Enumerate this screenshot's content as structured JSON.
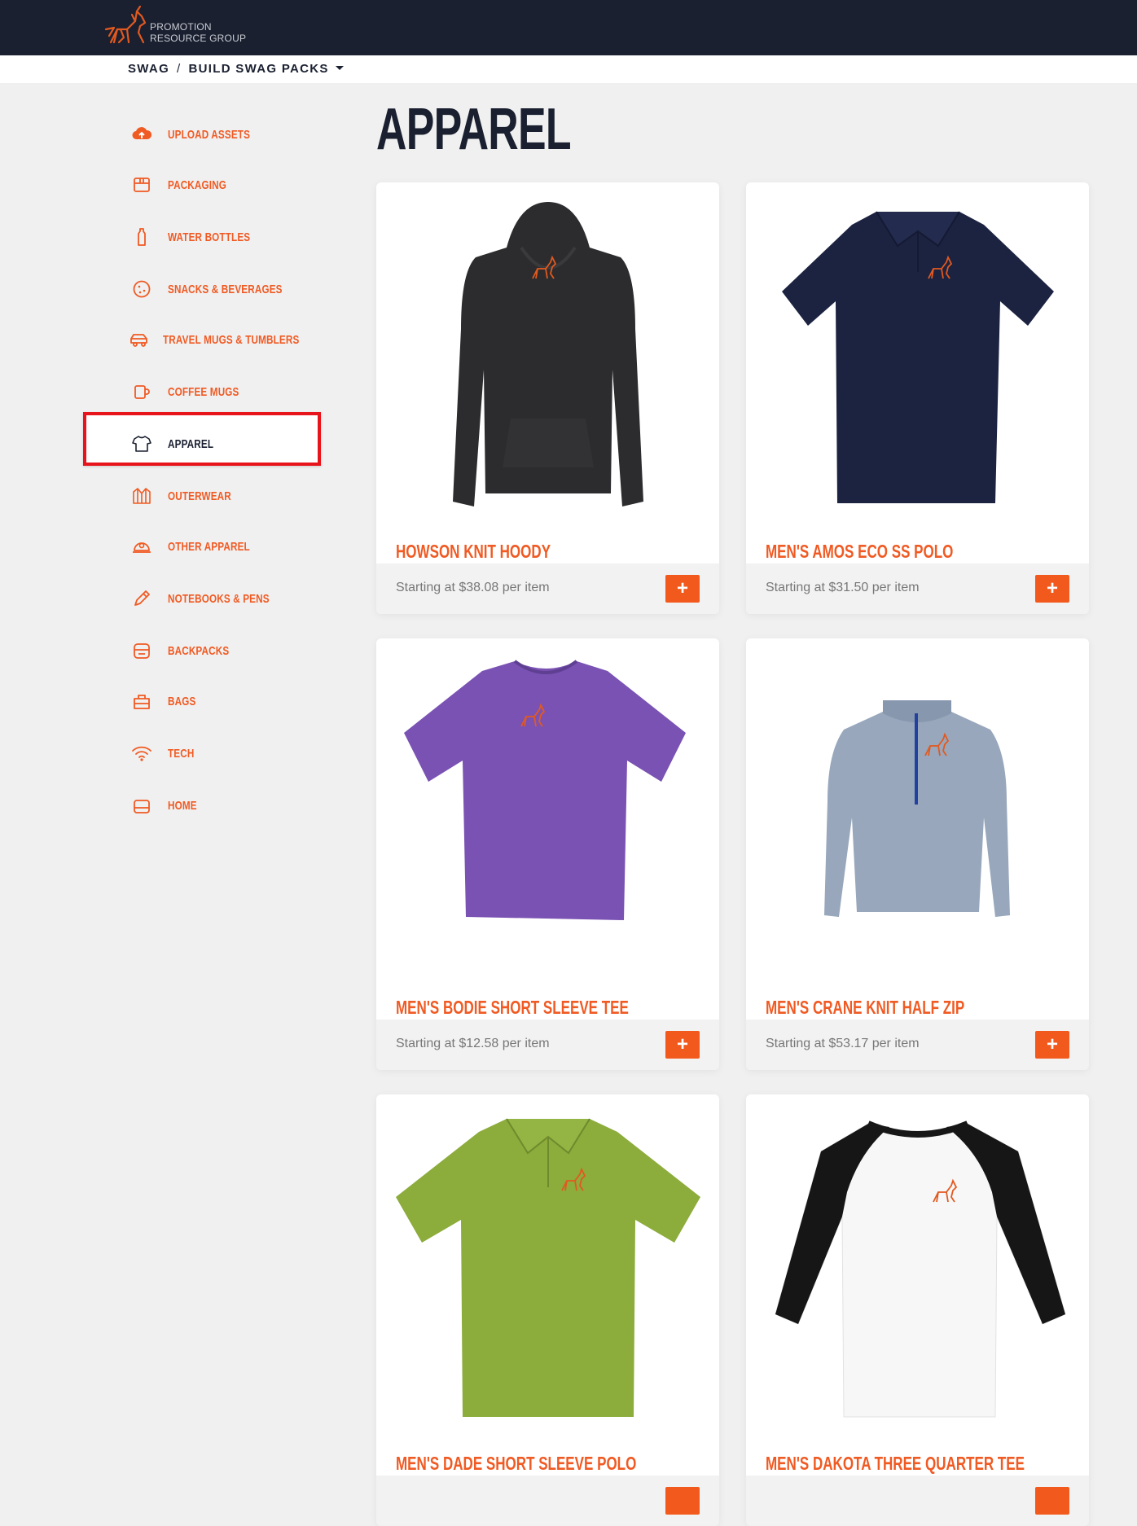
{
  "brand": {
    "name_line1": "PROMOTION",
    "name_line2": "RESOURCE GROUP",
    "accent": "#f05a23",
    "dark": "#1a2030"
  },
  "breadcrumb": {
    "root": "SWAG",
    "separator": "/",
    "current": "BUILD SWAG PACKS"
  },
  "sidebar": {
    "items": [
      {
        "label": "UPLOAD ASSETS",
        "icon": "cloud-upload-icon"
      },
      {
        "label": "PACKAGING",
        "icon": "box-icon"
      },
      {
        "label": "WATER BOTTLES",
        "icon": "bottle-icon"
      },
      {
        "label": "SNACKS & BEVERAGES",
        "icon": "cookie-icon"
      },
      {
        "label": "TRAVEL MUGS & TUMBLERS",
        "icon": "car-icon"
      },
      {
        "label": "COFFEE MUGS",
        "icon": "mug-icon"
      },
      {
        "label": "APPAREL",
        "icon": "tshirt-icon",
        "active": true
      },
      {
        "label": "OUTERWEAR",
        "icon": "jacket-icon"
      },
      {
        "label": "OTHER APPAREL",
        "icon": "cap-icon"
      },
      {
        "label": "NOTEBOOKS & PENS",
        "icon": "pen-icon"
      },
      {
        "label": "BACKPACKS",
        "icon": "backpack-icon"
      },
      {
        "label": "BAGS",
        "icon": "bag-icon"
      },
      {
        "label": "TECH",
        "icon": "wifi-icon"
      },
      {
        "label": "HOME",
        "icon": "home-icon"
      }
    ]
  },
  "main": {
    "title": "APPAREL",
    "products": [
      {
        "name": "HOWSON KNIT HOODY",
        "price": "Starting at $38.08 per item",
        "add": "+",
        "color": "#2c2c2e",
        "kind": "hoodie"
      },
      {
        "name": "MEN'S AMOS ECO SS POLO",
        "price": "Starting at $31.50 per item",
        "add": "+",
        "color": "#1c2340",
        "kind": "polo"
      },
      {
        "name": "MEN'S BODIE SHORT SLEEVE TEE",
        "price": "Starting at $12.58 per item",
        "add": "+",
        "color": "#7a52b3",
        "kind": "tee"
      },
      {
        "name": "MEN'S CRANE KNIT HALF ZIP",
        "price": "Starting at $53.17 per item",
        "add": "+",
        "color": "#98a7bc",
        "kind": "halfzip"
      },
      {
        "name": "MEN'S DADE SHORT SLEEVE POLO",
        "price": "",
        "add": "",
        "color": "#8cac3c",
        "kind": "polo"
      },
      {
        "name": "MEN'S DAKOTA THREE QUARTER TEE",
        "price": "",
        "add": "",
        "color": "#f7f7f7",
        "kind": "raglan"
      }
    ]
  }
}
